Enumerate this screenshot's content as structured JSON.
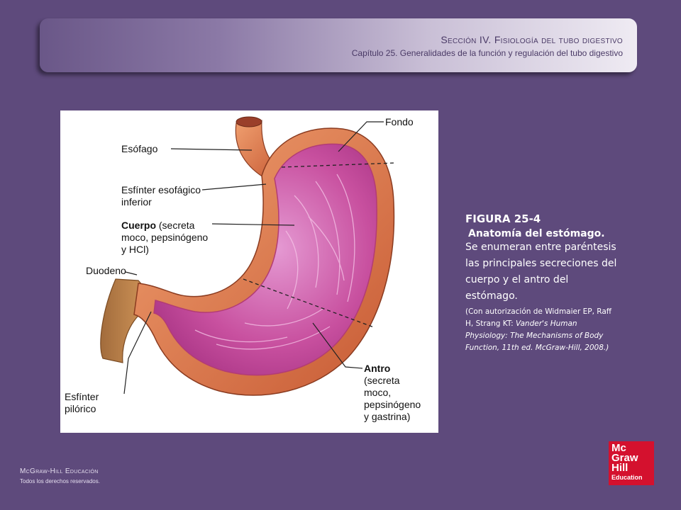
{
  "header": {
    "section": "Sección IV.  Fisiología del tubo digestivo",
    "chapter": "Capítulo 25.  Generalidades de la función y regulación del tubo digestivo"
  },
  "figure": {
    "labels": {
      "fondo": "Fondo",
      "esofago": "Esófago",
      "esfinter_esofagico": "Esfínter esofágico\ninferior",
      "cuerpo_bold": "Cuerpo",
      "cuerpo_rest": " (secreta\nmoco, pepsinógeno\ny HCl)",
      "duodeno": "Duodeno",
      "antro_bold": "Antro",
      "antro_rest": "\n(secreta\nmoco,\npepsinógeno\ny gastrina)",
      "esfinter_pilorico": "Esfínter\npilórico"
    }
  },
  "caption": {
    "number": "FIGURA 25-4",
    "title": "Anatomía del estómago.",
    "body": "Se enumeran entre paréntesis las principales secreciones del cuerpo y el antro del estómago.",
    "credit_prefix": "(Con autorización de Widmaier EP, Raff H, Strang KT: ",
    "credit_italic": "Vander's Human Physiology: The Mechanisms of Body Function, 11th ed. McGraw-Hill, 2008.)"
  },
  "footer": {
    "publisher": "McGraw-Hill Educación",
    "rights": "Todos los derechos reservados."
  },
  "logo": {
    "line1": "Mc",
    "line2": "Graw",
    "line3": "Hill",
    "line4": "Education"
  },
  "colors": {
    "background": "#5e4a7c",
    "logo_red": "#d4112e",
    "stomach_wall": "#e07a4e",
    "mucosa": "#c24aa6"
  }
}
